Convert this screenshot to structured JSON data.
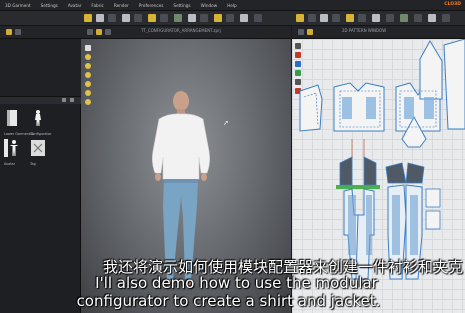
{
  "app": {
    "brand": "CLO3D"
  },
  "menubar": {
    "items": [
      "3D Garment",
      "Settings",
      "Avatar",
      "Fabric",
      "Render",
      "Preferences",
      "Settings",
      "Window",
      "Help"
    ]
  },
  "viewport3d": {
    "title": "TT_CONFIGURATOR_ARRANGEMENT.zprj"
  },
  "viewport2d": {
    "title": "2D PATTERN WINDOW"
  },
  "library": {
    "items": [
      {
        "label": "Lower Garment B",
        "icon": "garment-icon"
      },
      {
        "label": "Configurator",
        "icon": "avatar-icon"
      },
      {
        "label": "Avatar",
        "icon": "avatar-icon"
      },
      {
        "label": "Tag",
        "icon": "tag-icon"
      }
    ]
  },
  "subtitles": {
    "chinese": "我还将演示如何使用模块配置器来创建一件衬衫和夹克",
    "english_line1": "I'll also demo how to use the modular",
    "english_line2": "configurator to create a shirt and jacket."
  },
  "colors": {
    "accent": "#ff7a1a",
    "tool_yellow": "#d9b336",
    "pattern_blue": "#3b7fc4",
    "viewport_bg": "#7a7d82"
  }
}
